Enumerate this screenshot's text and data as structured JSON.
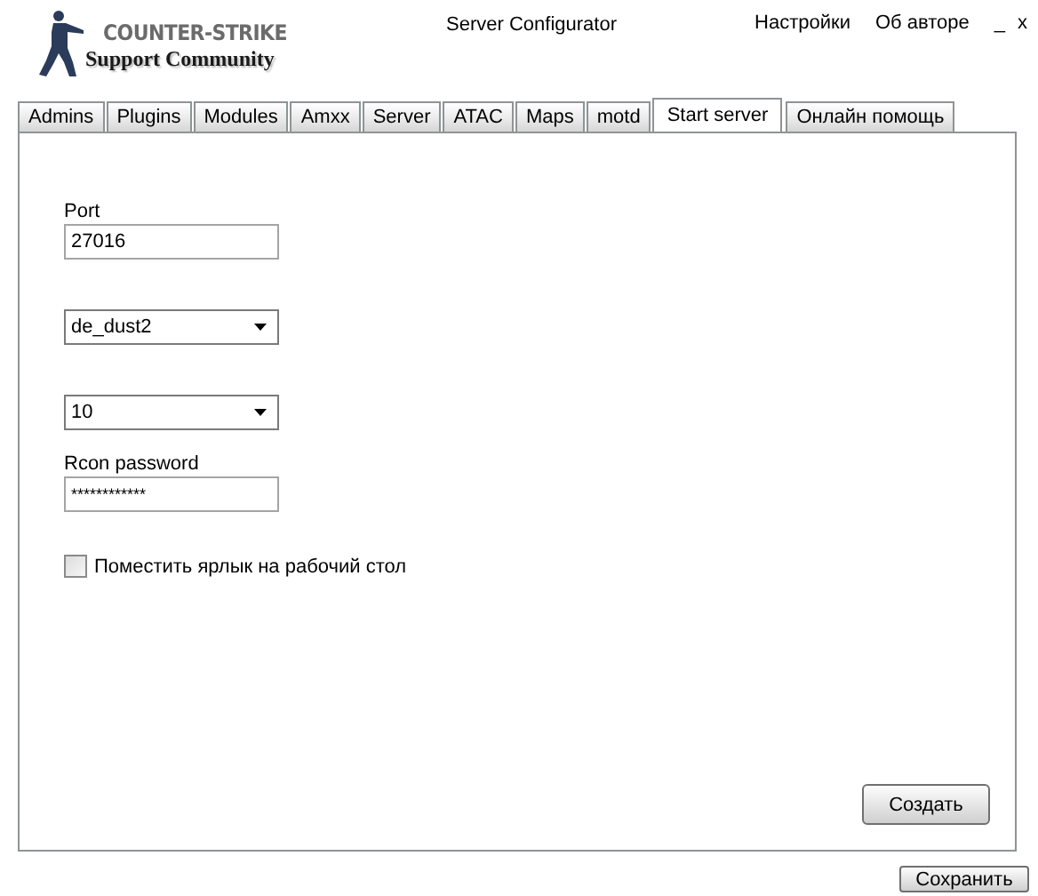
{
  "window": {
    "title": "Server Configurator",
    "logo": {
      "line_1": "COUNTER-STRIKE",
      "line_2": "Support Community"
    },
    "menu": [
      "Настройки",
      "Об авторе"
    ],
    "controls": [
      "_",
      "x"
    ]
  },
  "tabs": [
    {
      "label": "Admins",
      "selected": false
    },
    {
      "label": "Plugins",
      "selected": false
    },
    {
      "label": "Modules",
      "selected": false
    },
    {
      "label": "Amxx",
      "selected": false
    },
    {
      "label": "Server",
      "selected": false
    },
    {
      "label": "ATAC",
      "selected": false
    },
    {
      "label": "Maps",
      "selected": false
    },
    {
      "label": "motd",
      "selected": false
    },
    {
      "label": "Start server",
      "selected": true
    },
    {
      "label": "Онлайн помощь",
      "selected": false
    }
  ],
  "form": {
    "fields": [
      {
        "kind": "text",
        "label": "Port",
        "value": "27016"
      },
      {
        "kind": "dropdown",
        "value": "de_dust2"
      },
      {
        "kind": "dropdown",
        "value": "10"
      },
      {
        "kind": "text",
        "label": "Rcon password",
        "value": "************"
      },
      {
        "kind": "checkbox",
        "label": "Поместить ярлык на рабочий стол",
        "checked": false
      }
    ],
    "button": "Создать"
  },
  "footer": {
    "button": "Сохранить"
  }
}
